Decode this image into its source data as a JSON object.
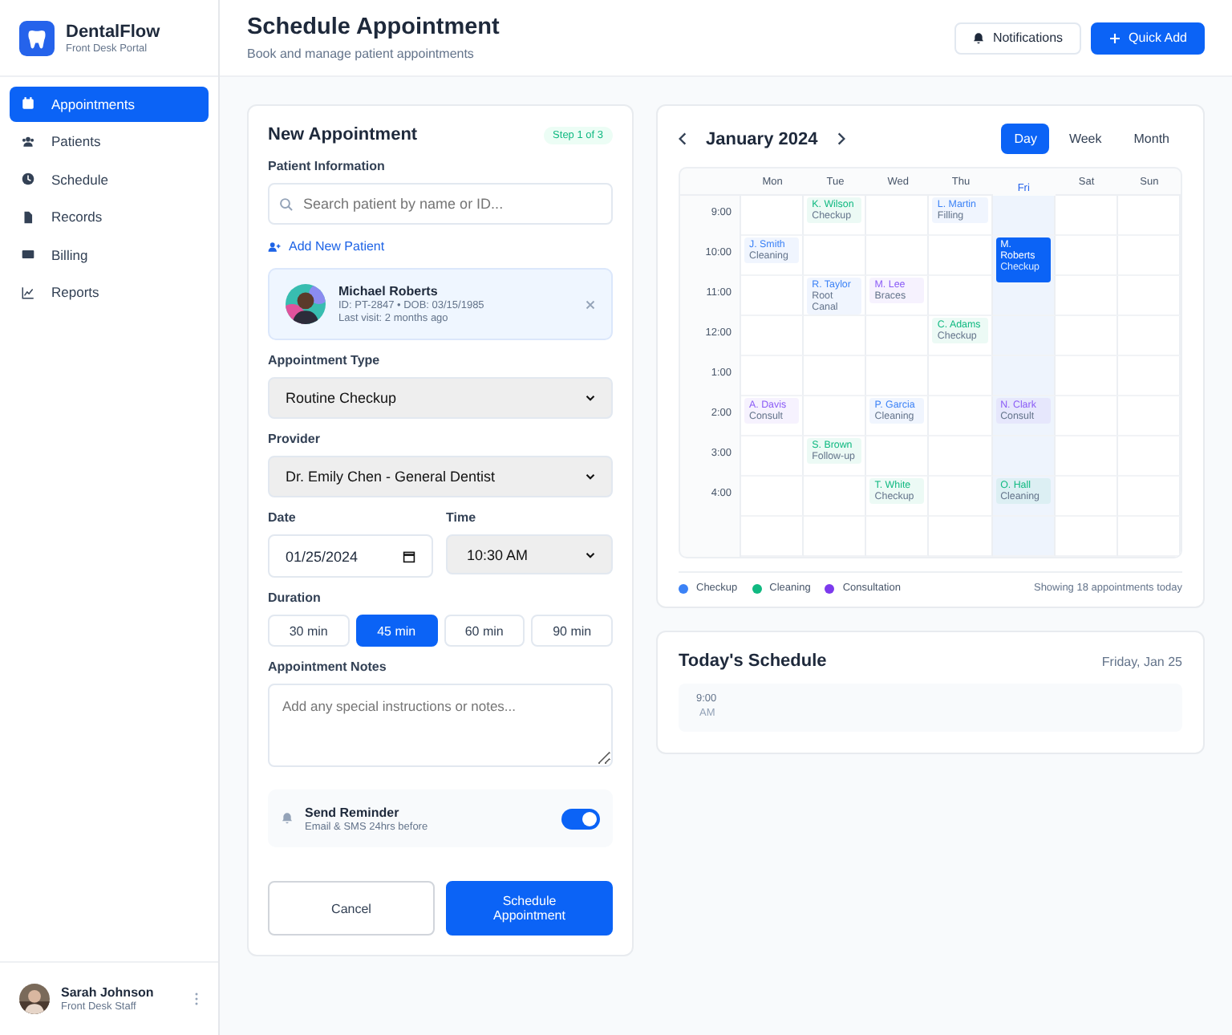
{
  "brand": {
    "name": "DentalFlow",
    "subtitle": "Front Desk Portal"
  },
  "sidebar": {
    "items": [
      {
        "label": "Appointments",
        "selected": true
      },
      {
        "label": "Patients",
        "selected": false
      },
      {
        "label": "Schedule",
        "selected": false
      },
      {
        "label": "Records",
        "selected": false
      },
      {
        "label": "Billing",
        "selected": false
      },
      {
        "label": "Reports",
        "selected": false
      }
    ],
    "user": {
      "name": "Sarah Johnson",
      "role": "Front Desk Staff"
    }
  },
  "header": {
    "title": "Schedule Appointment",
    "subtitle": "Book and manage patient appointments",
    "buttons": [
      {
        "label": "Notifications",
        "kind": "secondary"
      },
      {
        "label": "Quick Add",
        "kind": "primary"
      }
    ]
  },
  "form": {
    "title": "New Appointment",
    "step": "Step 1 of 3",
    "patient_label": "Patient Information",
    "search": {
      "placeholder": "Search patient by name or ID..."
    },
    "add_patient": "Add New Patient",
    "patient": {
      "name": "Michael Roberts",
      "details": "ID: PT-2847 • DOB: 03/15/1985",
      "last_visit": "Last visit: 2 months ago"
    },
    "type_label": "Appointment Type",
    "type_value": "Routine Checkup",
    "provider_label": "Provider",
    "provider_value": "Dr. Emily Chen - General Dentist",
    "date_label": "Date",
    "date_value": "01/25/2024",
    "time_label": "Time",
    "time_value": "10:30 AM",
    "duration_label": "Duration",
    "durations": [
      {
        "label": "30 min",
        "selected": false
      },
      {
        "label": "45 min",
        "selected": true
      },
      {
        "label": "60 min",
        "selected": false
      },
      {
        "label": "90 min",
        "selected": false
      }
    ],
    "notes_label": "Appointment Notes",
    "notes": {
      "placeholder": "Add any special instructions or notes..."
    },
    "reminder": {
      "title": "Send Reminder",
      "subtitle": "Email & SMS 24hrs before",
      "on": true
    },
    "cancel": "Cancel",
    "submit": "Schedule Appointment"
  },
  "calendar": {
    "month": "January 2024",
    "views": [
      {
        "label": "Day",
        "selected": true
      },
      {
        "label": "Week",
        "selected": false
      },
      {
        "label": "Month",
        "selected": false
      }
    ],
    "days": [
      {
        "label": "Mon",
        "selected": false
      },
      {
        "label": "Tue",
        "selected": false
      },
      {
        "label": "Wed",
        "selected": false
      },
      {
        "label": "Thu",
        "selected": false
      },
      {
        "label": "Fri",
        "selected": true
      },
      {
        "label": "Sat",
        "selected": false
      },
      {
        "label": "Sun",
        "selected": false
      }
    ],
    "rows": [
      {
        "time": "9:00",
        "cells": [
          null,
          {
            "name": "K. Wilson",
            "type": "Checkup",
            "color": "#10b981",
            "selected": false
          },
          null,
          {
            "name": "L. Martin",
            "type": "Filling",
            "color": "#3b82f6",
            "selected": false
          },
          null,
          null,
          null
        ]
      },
      {
        "time": "10:00",
        "cells": [
          {
            "name": "J. Smith",
            "type": "Cleaning",
            "color": "#3b82f6",
            "selected": false
          },
          null,
          null,
          null,
          {
            "name": "M. Roberts",
            "type": "Checkup",
            "color": "#0b63f6",
            "selected": true
          },
          null,
          null
        ]
      },
      {
        "time": "11:00",
        "cells": [
          null,
          {
            "name": "R. Taylor",
            "type": "Root Canal",
            "color": "#3b82f6",
            "selected": false
          },
          {
            "name": "M. Lee",
            "type": "Braces",
            "color": "#8b5cf6",
            "selected": false
          },
          null,
          null,
          null,
          null
        ]
      },
      {
        "time": "12:00",
        "cells": [
          null,
          null,
          null,
          {
            "name": "C. Adams",
            "type": "Checkup",
            "color": "#10b981",
            "selected": false
          },
          null,
          null,
          null
        ]
      },
      {
        "time": "1:00",
        "cells": [
          null,
          null,
          null,
          null,
          null,
          null,
          null
        ]
      },
      {
        "time": "2:00",
        "cells": [
          {
            "name": "A. Davis",
            "type": "Consult",
            "color": "#8b5cf6",
            "selected": false
          },
          null,
          {
            "name": "P. Garcia",
            "type": "Cleaning",
            "color": "#3b82f6",
            "selected": false
          },
          null,
          {
            "name": "N. Clark",
            "type": "Consult",
            "color": "#8b5cf6",
            "selected": false
          },
          null,
          null
        ]
      },
      {
        "time": "3:00",
        "cells": [
          null,
          {
            "name": "S. Brown",
            "type": "Follow-up",
            "color": "#10b981",
            "selected": false
          },
          null,
          null,
          null,
          null,
          null
        ]
      },
      {
        "time": "4:00",
        "cells": [
          null,
          null,
          {
            "name": "T. White",
            "type": "Checkup",
            "color": "#10b981",
            "selected": false
          },
          null,
          {
            "name": "O. Hall",
            "type": "Cleaning",
            "color": "#10b981",
            "selected": false
          },
          null,
          null
        ]
      }
    ],
    "legend": [
      {
        "label": "Checkup",
        "color": "#3b82f6"
      },
      {
        "label": "Cleaning",
        "color": "#10b981"
      },
      {
        "label": "Consultation",
        "color": "#7c3aed"
      }
    ],
    "summary": "Showing 18 appointments today"
  },
  "today": {
    "title": "Today's Schedule",
    "date": "Friday, Jan 25",
    "slots": [
      {
        "time": "9:00",
        "period": "AM"
      }
    ]
  }
}
